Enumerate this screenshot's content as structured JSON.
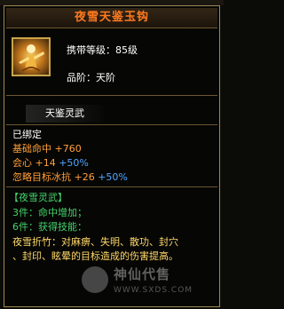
{
  "title": "夜雪天鉴玉钩",
  "item_icon": "gold-character-icon",
  "requirement": {
    "level": "携带等级：85级",
    "grade": "品阶：天阶"
  },
  "set_tag": "天鉴灵武",
  "bound": "已绑定",
  "stats": [
    {
      "name": "基础命中",
      "value": "+760"
    },
    {
      "name": "会心",
      "value": "+14",
      "extra": "+50%"
    },
    {
      "name": "忽略目标冰抗",
      "value": "+26",
      "extra": "+50%"
    }
  ],
  "set": {
    "title": "【夜雪灵武】",
    "piece3": "3件：命中增加；",
    "piece6": "6件：获得技能：",
    "skill_line1": "夜雪折竹：对麻痹、失明、散功、封穴",
    "skill_line2": "、封印、眩晕的目标造成的伤害提高。"
  },
  "watermark": {
    "text": "神仙代售",
    "url": "WWW.SXDS.COM"
  },
  "colors": {
    "title": "#ff7a1f",
    "stat": "#ff9f3a",
    "bonus": "#4fa6ff",
    "set": "#45d36b",
    "skill": "#ffd86a"
  }
}
